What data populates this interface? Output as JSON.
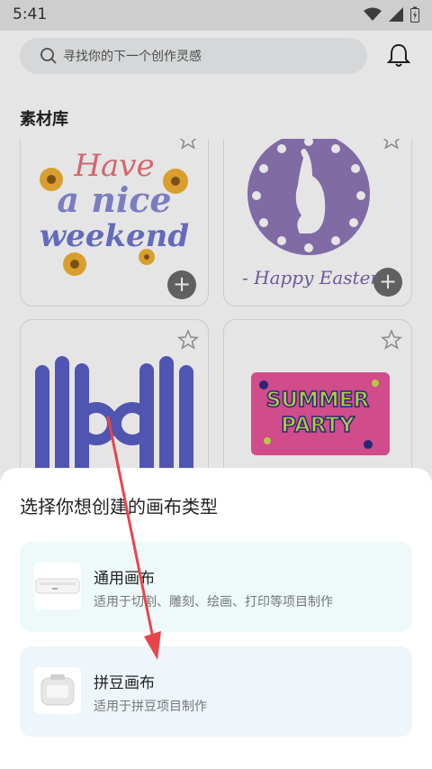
{
  "status_bar": {
    "time": "5:41"
  },
  "search": {
    "placeholder": "寻找你的下一个创作灵感"
  },
  "library": {
    "title": "素材库"
  },
  "cards": [
    {
      "text_lines": [
        "Have",
        "a nice",
        "weekend"
      ]
    },
    {
      "text": "- Happy Easter"
    },
    {
      "text": ""
    },
    {
      "text_lines": [
        "SUMMER",
        "PARTY"
      ]
    }
  ],
  "sheet": {
    "title": "选择你想创建的画布类型",
    "options": [
      {
        "name": "通用画布",
        "desc": "适用于切割、雕刻、绘画、打印等项目制作"
      },
      {
        "name": "拼豆画布",
        "desc": "适用于拼豆项目制作"
      }
    ]
  },
  "colors": {
    "accent_arrow": "#e8454a",
    "sheet_option_1": "#eefafa",
    "sheet_option_2": "#eef5fb"
  }
}
